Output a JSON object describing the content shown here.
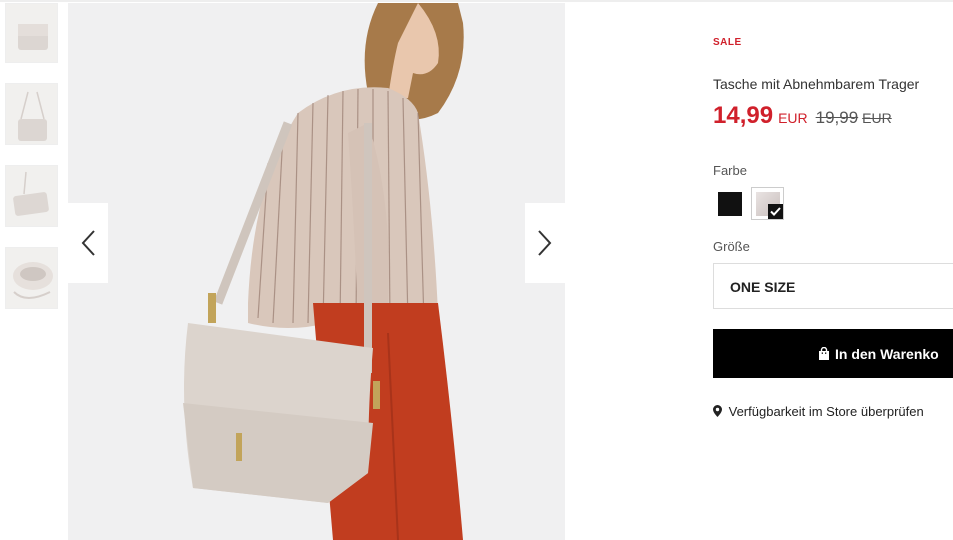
{
  "gallery": {
    "thumbnails": [
      {
        "name": "thumbnail-bag-front"
      },
      {
        "name": "thumbnail-bag-strap"
      },
      {
        "name": "thumbnail-bag-side"
      },
      {
        "name": "thumbnail-bag-open"
      }
    ],
    "prev_icon": "chevron-left-icon",
    "next_icon": "chevron-right-icon"
  },
  "product": {
    "badge": "SALE",
    "title": "Tasche mit Abnehmbarem Trager",
    "price_now": "14,99",
    "currency_now": "EUR",
    "price_old": "19,99",
    "currency_old": "EUR",
    "color_label": "Farbe",
    "colors": [
      {
        "name": "black",
        "hex": "#111111",
        "selected": false
      },
      {
        "name": "beige",
        "hex": "#d9d0ce",
        "selected": true
      }
    ],
    "size_label": "Größe",
    "size_value": "ONE SIZE",
    "cart_label": "In den Warenko",
    "store_label": "Verfügbarkeit im Store überprüfen"
  },
  "colors": {
    "sale_red": "#d0202b",
    "button_black": "#000000"
  }
}
